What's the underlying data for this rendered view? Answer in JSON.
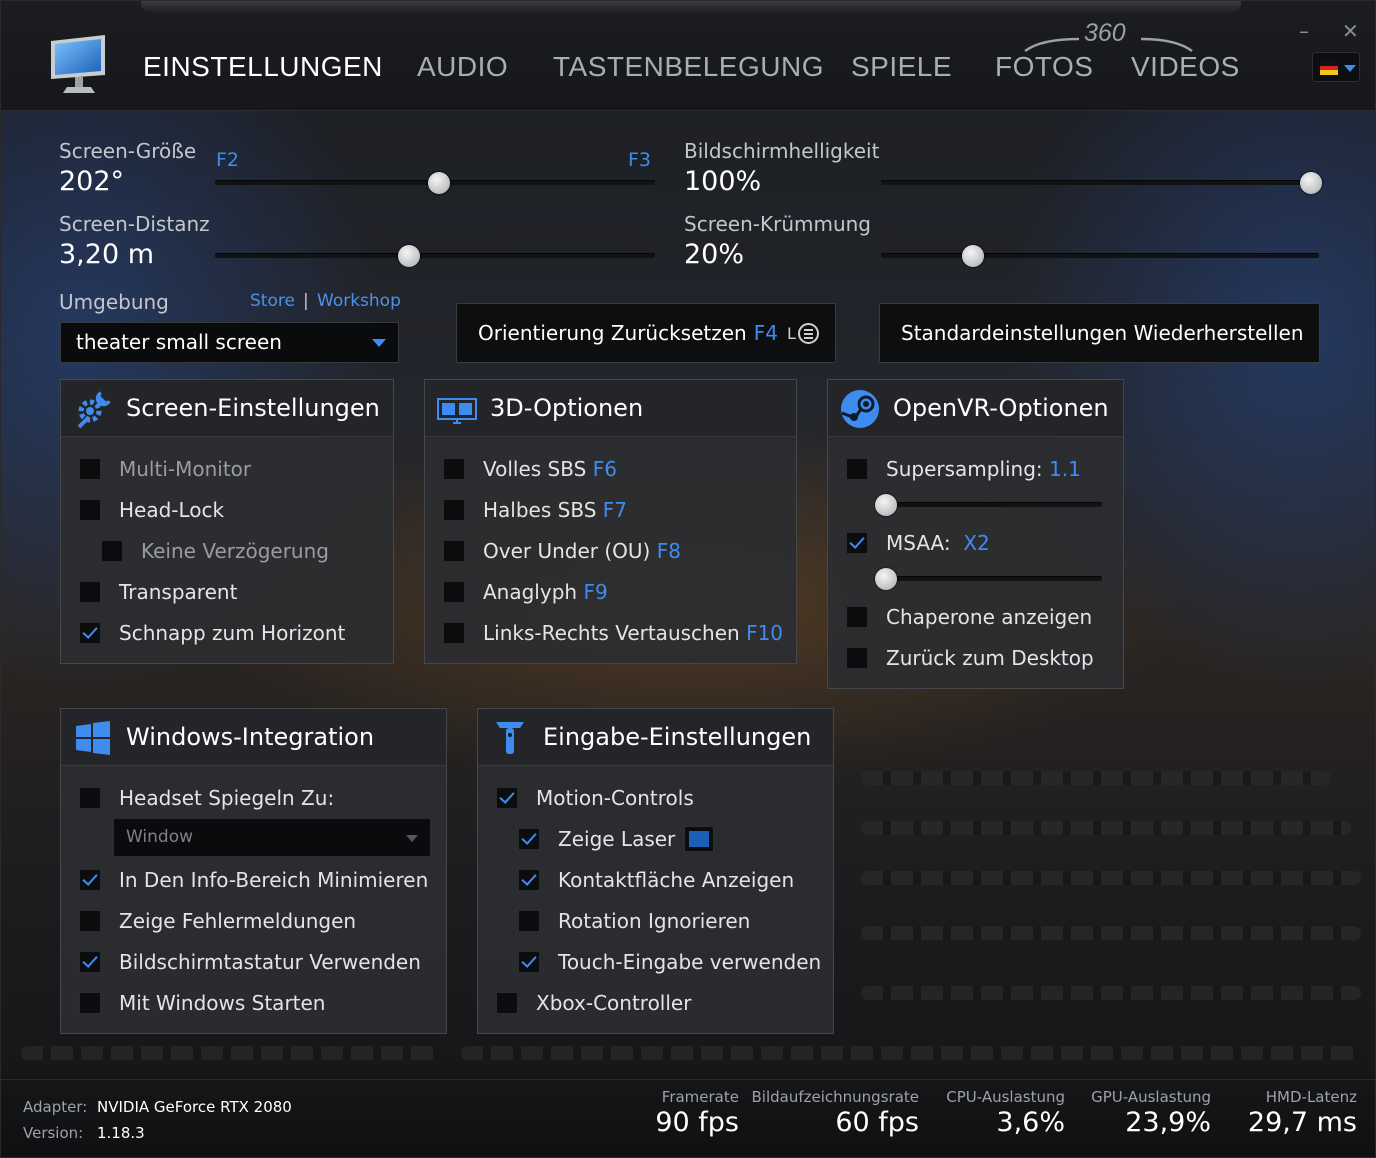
{
  "nav": {
    "tabs": [
      {
        "label": "EINSTELLUNGEN",
        "active": true
      },
      {
        "label": "AUDIO"
      },
      {
        "label": "TASTENBELEGUNG"
      },
      {
        "label": "SPIELE"
      },
      {
        "label": "FOTOS"
      },
      {
        "label": "VIDEOS"
      }
    ],
    "label_360": "360",
    "minimize": "–",
    "close": "✕",
    "language_flag": "de-flag-icon"
  },
  "sliders": {
    "screen_size": {
      "label": "Screen-Größe",
      "value": "202°",
      "key_left": "F2",
      "key_right": "F3",
      "level": 0.51
    },
    "brightness": {
      "label": "Bildschirmhelligkeit",
      "value": "100%",
      "level": 1.0
    },
    "screen_distance": {
      "label": "Screen-Distanz",
      "value": "3,20 m",
      "level": 0.44
    },
    "curvature": {
      "label": "Screen-Krümmung",
      "value": "20%",
      "level": 0.21
    }
  },
  "environment": {
    "label": "Umgebung",
    "store": "Store",
    "separator": "|",
    "workshop": "Workshop",
    "selected": "theater small screen"
  },
  "buttons": {
    "reset_orientation": "Orientierung Zurücksetzen",
    "reset_key": "F4",
    "reset_badge": "L",
    "restore_defaults": "Standardeinstellungen Wiederherstellen"
  },
  "screen_settings": {
    "title": "Screen-Einstellungen",
    "options": [
      {
        "label": "Multi-Monitor",
        "checked": false,
        "disabled": true
      },
      {
        "label": "Head-Lock",
        "checked": false
      },
      {
        "label": "Keine Verzögerung",
        "checked": false,
        "disabled": true
      },
      {
        "label": "Transparent",
        "checked": false
      },
      {
        "label": "Schnapp zum Horizont",
        "checked": true
      }
    ]
  },
  "options_3d": {
    "title": "3D-Optionen",
    "options": [
      {
        "label": "Volles SBS",
        "key": "F6",
        "checked": false
      },
      {
        "label": "Halbes SBS",
        "key": "F7",
        "checked": false
      },
      {
        "label": "Over Under (OU)",
        "key": "F8",
        "checked": false
      },
      {
        "label": "Anaglyph",
        "key": "F9",
        "checked": false
      },
      {
        "label": "Links-Rechts Vertauschen",
        "key": "F10",
        "checked": false
      }
    ]
  },
  "openvr": {
    "title": "OpenVR-Optionen",
    "supersampling": {
      "label": "Supersampling:",
      "value": "1.1",
      "checked": false,
      "level": 0.0
    },
    "msaa": {
      "label": "MSAA:",
      "value": "X2",
      "checked": true,
      "level": 0.0
    },
    "chaperone": {
      "label": "Chaperone anzeigen",
      "checked": false
    },
    "back_desktop": {
      "label": "Zurück zum Desktop",
      "checked": false
    }
  },
  "windows": {
    "title": "Windows-Integration",
    "mirror": {
      "label": "Headset Spiegeln Zu:",
      "checked": false
    },
    "mirror_select": "Window",
    "options": [
      {
        "label": "In Den Info-Bereich Minimieren",
        "checked": true
      },
      {
        "label": "Zeige Fehlermeldungen",
        "checked": false
      },
      {
        "label": "Bildschirmtastatur Verwenden",
        "checked": true
      },
      {
        "label": "Mit Windows Starten",
        "checked": false
      }
    ]
  },
  "input": {
    "title": "Eingabe-Einstellungen",
    "options": [
      {
        "label": "Motion-Controls",
        "checked": true
      },
      {
        "label": "Zeige Laser",
        "checked": true
      },
      {
        "label": "Kontaktfläche Anzeigen",
        "checked": true
      },
      {
        "label": "Rotation Ignorieren",
        "checked": false
      },
      {
        "label": "Touch-Eingabe verwenden",
        "checked": true
      },
      {
        "label": "Xbox-Controller",
        "checked": false
      }
    ],
    "laser_color": "#1b5fb8"
  },
  "status": {
    "adapter_label": "Adapter:",
    "adapter_value": "NVIDIA GeForce RTX 2080",
    "version_label": "Version:",
    "version_value": "1.18.3",
    "metrics": [
      {
        "label": "Framerate",
        "value": "90 fps"
      },
      {
        "label": "Bildaufzeichnungsrate",
        "value": "60 fps"
      },
      {
        "label": "CPU-Auslastung",
        "value": "3,6%"
      },
      {
        "label": "GPU-Auslastung",
        "value": "23,9%"
      },
      {
        "label": "HMD-Latenz",
        "value": "29,7 ms"
      }
    ]
  },
  "colors": {
    "accent": "#3f8cf0",
    "background": "#1d1e21",
    "panel": "#2c2d30"
  }
}
